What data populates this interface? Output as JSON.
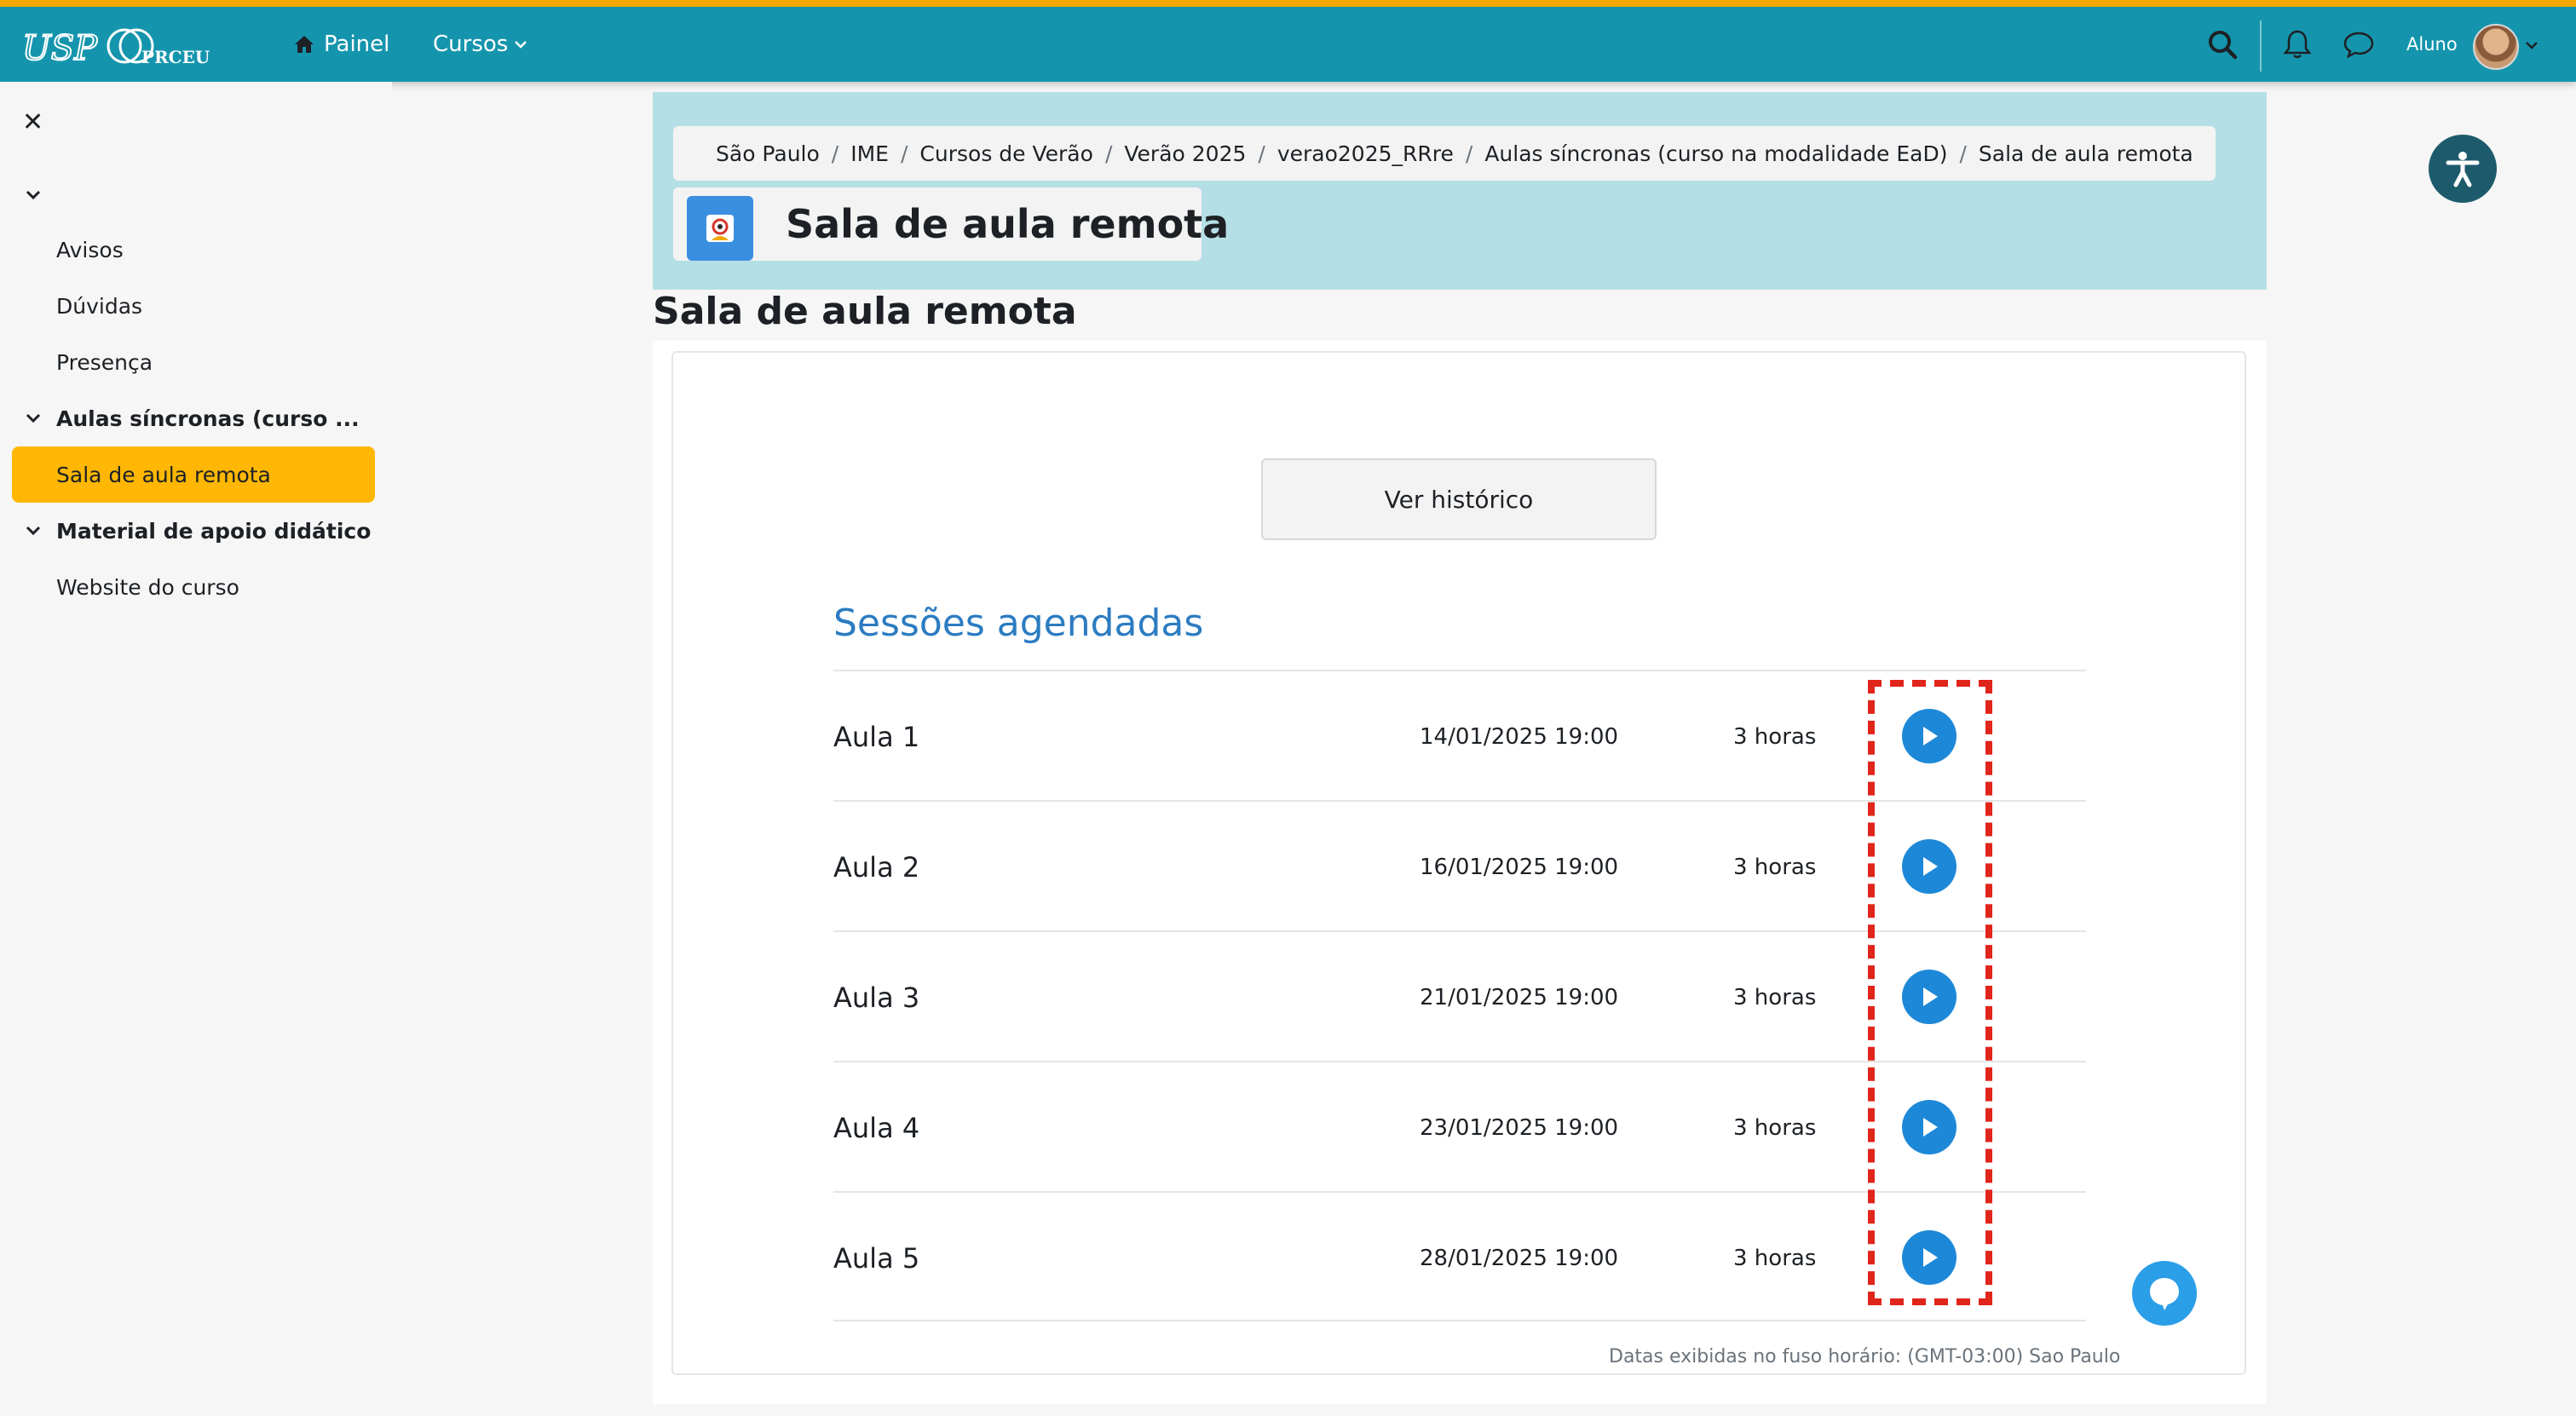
{
  "topbar": {
    "logo_usp": "USP",
    "logo_prceu": "PRCEU",
    "nav_painel": "Painel",
    "nav_cursos": "Cursos",
    "user_role": "Aluno"
  },
  "sidebar": {
    "items": [
      {
        "label": "Avisos"
      },
      {
        "label": "Dúvidas"
      },
      {
        "label": "Presença"
      },
      {
        "label": "Aulas síncronas (curso ..."
      },
      {
        "label": "Sala de aula remota"
      },
      {
        "label": "Material de apoio didático"
      },
      {
        "label": "Website do curso"
      }
    ]
  },
  "breadcrumb": [
    "São Paulo",
    "IME",
    "Cursos de Verão",
    "Verão 2025",
    "verao2025_RRre",
    "Aulas síncronas (curso na modalidade EaD)",
    "Sala de aula remota"
  ],
  "header": {
    "title": "Sala de aula remota"
  },
  "main": {
    "title": "Sala de aula remota",
    "history_button": "Ver histórico",
    "sessions_title": "Sessões agendadas",
    "sessions": [
      {
        "name": "Aula 1",
        "datetime": "14/01/2025 19:00",
        "duration": "3 horas"
      },
      {
        "name": "Aula 2",
        "datetime": "16/01/2025 19:00",
        "duration": "3 horas"
      },
      {
        "name": "Aula 3",
        "datetime": "21/01/2025 19:00",
        "duration": "3 horas"
      },
      {
        "name": "Aula 4",
        "datetime": "23/01/2025 19:00",
        "duration": "3 horas"
      },
      {
        "name": "Aula 5",
        "datetime": "28/01/2025 19:00",
        "duration": "3 horas"
      }
    ],
    "timezone_note": "Datas exibidas no fuso horário: (GMT-03:00) Sao Paulo"
  },
  "icons": {
    "home": "home-icon",
    "search": "search-icon",
    "bell": "bell-icon",
    "chat": "chat-bubble-icon",
    "play": "play-icon",
    "accessibility": "accessibility-icon",
    "close": "close-icon"
  },
  "colors": {
    "navbar": "#1595ad",
    "navbar_accent": "#f2a900",
    "header_bg": "#b5dfe6",
    "active_item": "#ffb703",
    "play_button": "#1e88d8",
    "sessions_title": "#2c7cc1",
    "highlight": "#e0251b"
  }
}
